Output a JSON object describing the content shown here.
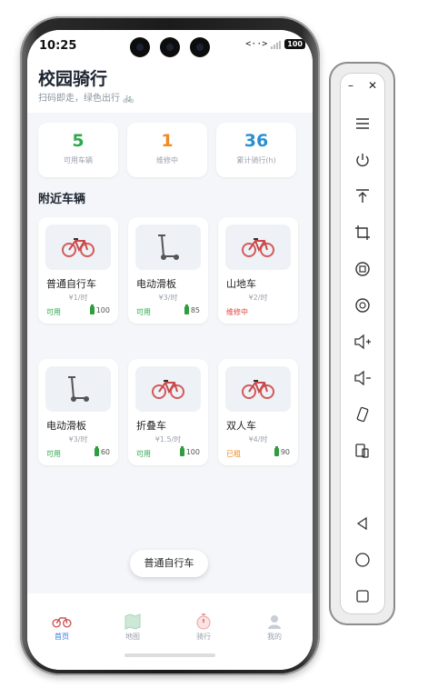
{
  "status_bar": {
    "time": "10:25",
    "signal_text": "<··>",
    "battery": "100"
  },
  "header": {
    "title": "校园骑行",
    "subtitle": "扫码即走，绿色出行 🚲"
  },
  "stats": [
    {
      "value": "5",
      "label": "可用车辆",
      "color": "#2ea84f"
    },
    {
      "value": "1",
      "label": "维修中",
      "color": "#f08a24"
    },
    {
      "value": "36",
      "label": "累计骑行(h)",
      "color": "#2a8fd0"
    }
  ],
  "section_title": "附近车辆",
  "vehicles": [
    {
      "name": "普通自行车",
      "price": "¥1/时",
      "status": "可用",
      "status_color": "green",
      "battery": "100",
      "icon": "bicycle-icon"
    },
    {
      "name": "电动滑板",
      "price": "¥3/时",
      "status": "可用",
      "status_color": "green",
      "battery": "85",
      "icon": "scooter-icon"
    },
    {
      "name": "山地车",
      "price": "¥2/时",
      "status": "维修中",
      "status_color": "red",
      "battery": "",
      "icon": "bicycle-icon"
    },
    {
      "name": "电动滑板",
      "price": "¥3/时",
      "status": "可用",
      "status_color": "green",
      "battery": "60",
      "icon": "scooter-icon"
    },
    {
      "name": "折叠车",
      "price": "¥1.5/时",
      "status": "可用",
      "status_color": "green",
      "battery": "100",
      "icon": "bicycle-icon"
    },
    {
      "name": "双人车",
      "price": "¥4/时",
      "status": "已租",
      "status_color": "orange",
      "battery": "90",
      "icon": "bicycle-icon"
    }
  ],
  "toast": "普通自行车",
  "tabs": [
    {
      "label": "首页",
      "icon": "bicycle-icon",
      "active": true
    },
    {
      "label": "地图",
      "icon": "map-icon",
      "active": false
    },
    {
      "label": "骑行",
      "icon": "timer-icon",
      "active": false
    },
    {
      "label": "我的",
      "icon": "user-icon",
      "active": false
    }
  ],
  "side_panel": {
    "buttons": [
      "menu-icon",
      "power-icon",
      "top-icon",
      "crop-icon",
      "rotate-icon",
      "screenshot-icon",
      "volume-up-icon",
      "volume-down-icon",
      "rotate-screen-icon",
      "fold-icon",
      "back-icon",
      "home-icon",
      "recents-icon"
    ]
  }
}
